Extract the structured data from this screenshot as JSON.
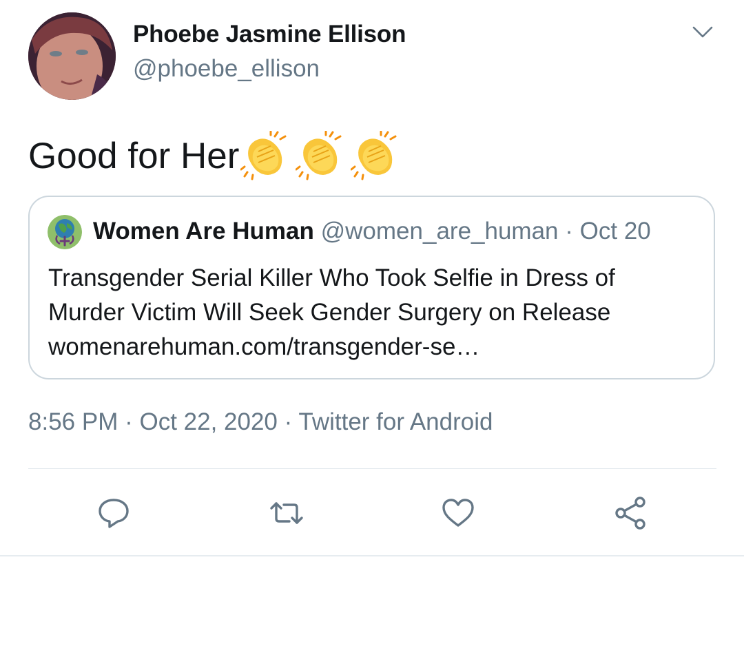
{
  "author": {
    "display_name": "Phoebe Jasmine Ellison",
    "handle": "@phoebe_ellison",
    "avatar_icon": "profile-photo"
  },
  "tweet": {
    "text": "Good for Her",
    "emojis": [
      "clapping-hands",
      "clapping-hands",
      "clapping-hands"
    ]
  },
  "quoted_tweet": {
    "display_name": "Women Are Human",
    "handle": "@women_are_human",
    "separator": "·",
    "date": "Oct 20",
    "body_lines": [
      "Transgender Serial Killer Who Took Selfie in Dress of",
      "Murder Victim Will Seek Gender Surgery on Release",
      "womenarehuman.com/transgender-se…"
    ]
  },
  "meta": {
    "time": "8:56 PM",
    "separator": "·",
    "date": "Oct 22, 2020",
    "source": "Twitter for Android"
  },
  "actions": [
    {
      "name": "reply",
      "icon": "reply-icon"
    },
    {
      "name": "retweet",
      "icon": "retweet-icon"
    },
    {
      "name": "like",
      "icon": "heart-icon"
    },
    {
      "name": "share",
      "icon": "share-icon"
    }
  ],
  "colors": {
    "text_primary": "#14171a",
    "text_secondary": "#657786",
    "border": "#ccd6dd",
    "icon_gray": "#657786"
  }
}
